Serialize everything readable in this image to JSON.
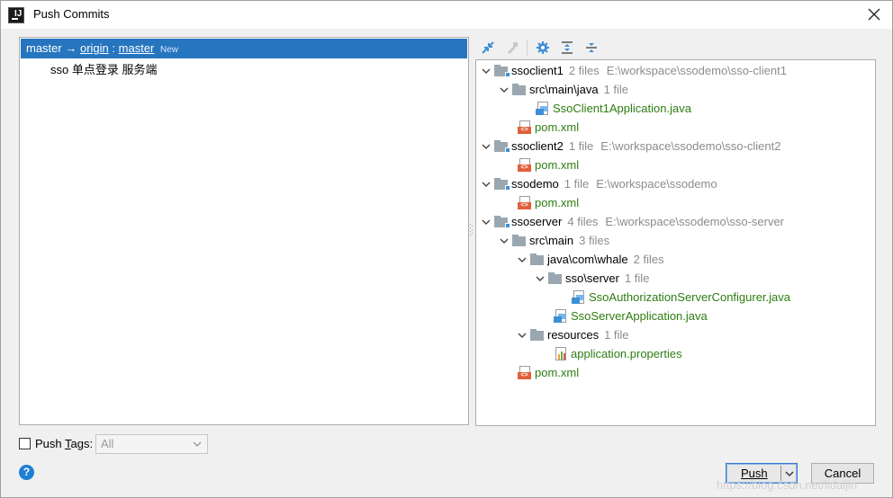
{
  "window": {
    "title": "Push Commits"
  },
  "commits_panel": {
    "branch_row": {
      "local": "master",
      "arrow": "→",
      "remote": "origin",
      "sep": ":",
      "remote_branch": "master",
      "badge": "New"
    },
    "commit_message": "sso 单点登录 服务端"
  },
  "toolbar": {
    "icons": [
      "expand-diff-icon",
      "collapse-diff-icon",
      "settings-icon",
      "expand-all-icon",
      "collapse-all-icon"
    ]
  },
  "tree": [
    {
      "id": "r0",
      "depth": 0,
      "type": "module",
      "expanded": true,
      "name": "ssoclient1",
      "meta": "2 files",
      "path": "E:\\workspace\\ssodemo\\sso-client1"
    },
    {
      "id": "r1",
      "depth": 1,
      "type": "folder",
      "expanded": true,
      "name": "src\\main\\java",
      "meta": "1 file",
      "path": ""
    },
    {
      "id": "r2",
      "depth": 3,
      "type": "java",
      "name": "SsoClient1Application.java",
      "meta": "",
      "path": ""
    },
    {
      "id": "r3",
      "depth": 2,
      "type": "xml",
      "name": "pom.xml",
      "meta": "",
      "path": ""
    },
    {
      "id": "r4",
      "depth": 0,
      "type": "module",
      "expanded": true,
      "name": "ssoclient2",
      "meta": "1 file",
      "path": "E:\\workspace\\ssodemo\\sso-client2"
    },
    {
      "id": "r5",
      "depth": 2,
      "type": "xml",
      "name": "pom.xml",
      "meta": "",
      "path": ""
    },
    {
      "id": "r6",
      "depth": 0,
      "type": "module",
      "expanded": true,
      "name": "ssodemo",
      "meta": "1 file",
      "path": "E:\\workspace\\ssodemo"
    },
    {
      "id": "r7",
      "depth": 2,
      "type": "xml",
      "name": "pom.xml",
      "meta": "",
      "path": ""
    },
    {
      "id": "r8",
      "depth": 0,
      "type": "module",
      "expanded": true,
      "name": "ssoserver",
      "meta": "4 files",
      "path": "E:\\workspace\\ssodemo\\sso-server"
    },
    {
      "id": "r9",
      "depth": 1,
      "type": "folder",
      "expanded": true,
      "name": "src\\main",
      "meta": "3 files",
      "path": ""
    },
    {
      "id": "r10",
      "depth": 2,
      "type": "folder",
      "expanded": true,
      "name": "java\\com\\whale",
      "meta": "2 files",
      "path": ""
    },
    {
      "id": "r11",
      "depth": 3,
      "type": "folder",
      "expanded": true,
      "name": "sso\\server",
      "meta": "1 file",
      "path": ""
    },
    {
      "id": "r12",
      "depth": 5,
      "type": "java",
      "name": "SsoAuthorizationServerConfigurer.java",
      "meta": "",
      "path": ""
    },
    {
      "id": "r13",
      "depth": 4,
      "type": "java",
      "name": "SsoServerApplication.java",
      "meta": "",
      "path": ""
    },
    {
      "id": "r14",
      "depth": 2,
      "type": "folder",
      "expanded": true,
      "name": "resources",
      "meta": "1 file",
      "path": ""
    },
    {
      "id": "r15",
      "depth": 4,
      "type": "properties",
      "name": "application.properties",
      "meta": "",
      "path": ""
    },
    {
      "id": "r16",
      "depth": 2,
      "type": "xml",
      "name": "pom.xml",
      "meta": "",
      "path": ""
    }
  ],
  "footer": {
    "push_tags_label_prefix": "Push ",
    "push_tags_label_mnemonic": "T",
    "push_tags_label_suffix": "ags:",
    "push_tags_checked": false,
    "tags_select_value": "All",
    "help": "?",
    "push_button_label": "Push",
    "cancel_button_label": "Cancel"
  },
  "watermark": "https://blog.csdn.net/lidaijin"
}
